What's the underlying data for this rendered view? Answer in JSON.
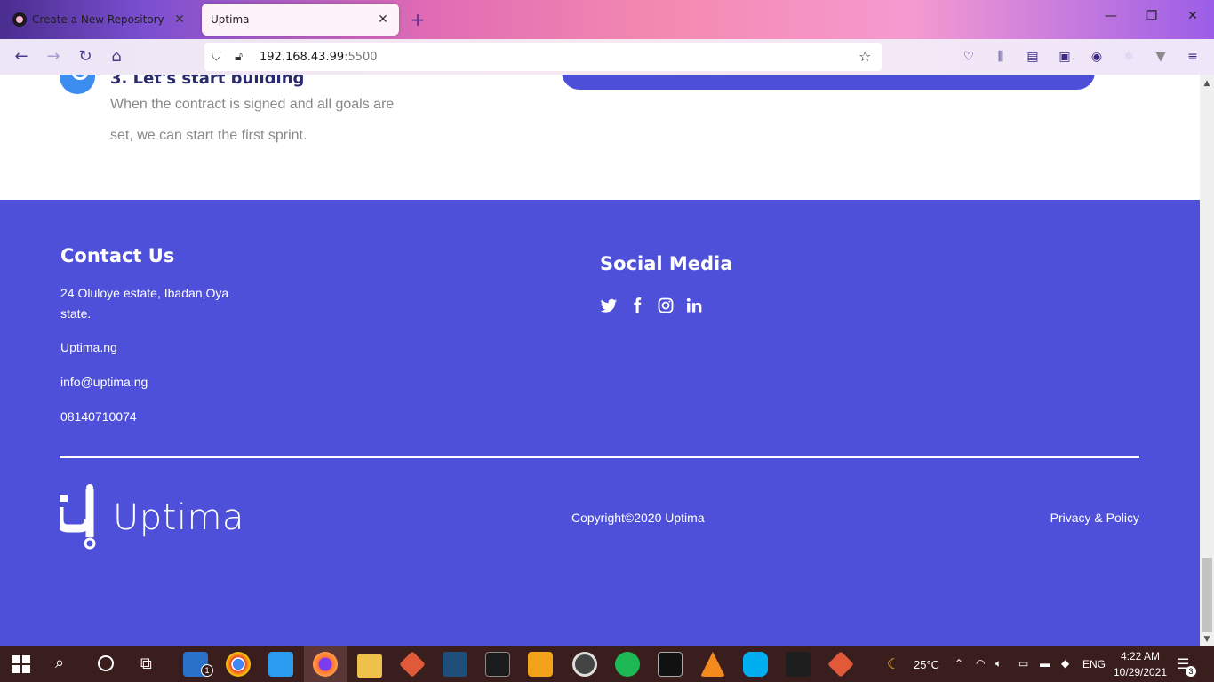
{
  "browser": {
    "tabs": [
      {
        "title": "Create a New Repository",
        "active": false
      },
      {
        "title": "Uptima",
        "active": true
      }
    ],
    "url_host": "192.168.43.99",
    "url_port": ":5500"
  },
  "page": {
    "step": {
      "title": "3. Let's start building",
      "description": "When the contract is signed and all goals are set, we can start the first sprint."
    },
    "footer": {
      "contact_heading": "Contact Us",
      "address_line1": "24 Oluloye estate, Ibadan,Oya",
      "address_line2": "state.",
      "website": "Uptima.ng",
      "email": "info@uptima.ng",
      "phone": "08140710074",
      "social_heading": "Social Media",
      "social_icons": [
        "twitter-icon",
        "facebook-icon",
        "instagram-icon",
        "linkedin-icon"
      ],
      "logo_text": "Uptima",
      "copyright": "Copyright©2020 Uptima",
      "privacy": "Privacy & Policy"
    },
    "colors": {
      "footer_bg": "#4e50da",
      "accent_blue": "#3d8cf0",
      "heading_dark": "#2a2a6e"
    }
  },
  "taskbar": {
    "weather": "25°C",
    "language": "ENG",
    "time": "4:22 AM",
    "date": "10/29/2021",
    "notification_count": "3",
    "mail_badge": "1"
  }
}
